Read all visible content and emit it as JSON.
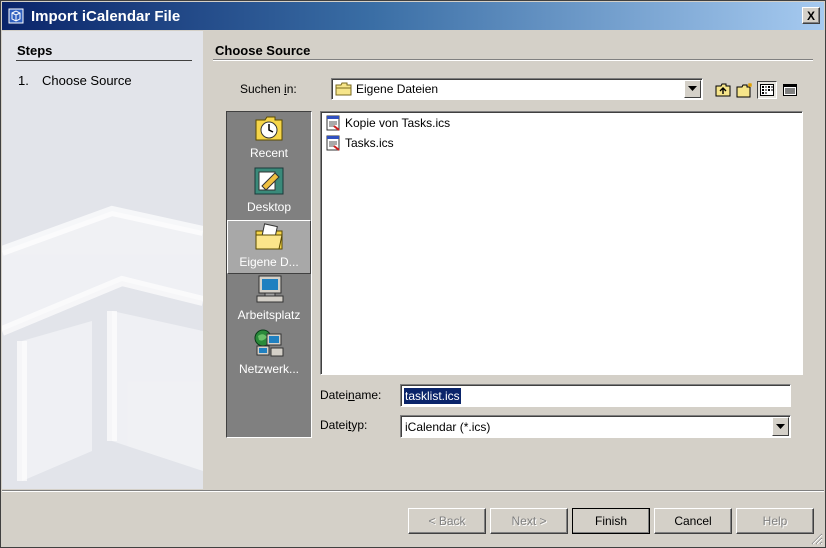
{
  "window": {
    "title": "Import iCalendar File",
    "close_label": "X"
  },
  "steps": {
    "title": "Steps",
    "items": [
      {
        "number": "1.",
        "label": "Choose Source"
      }
    ]
  },
  "main": {
    "title": "Choose Source"
  },
  "look_in": {
    "label_pre": "Suchen ",
    "label_mnemonic": "i",
    "label_post": "n:",
    "value": "Eigene Dateien"
  },
  "toolbar": {
    "icons": [
      "up-folder-icon",
      "new-folder-icon",
      "list-view-icon",
      "details-view-icon"
    ],
    "selected_view": "list"
  },
  "places": [
    {
      "label": "Recent",
      "icon": "recent-icon"
    },
    {
      "label": "Desktop",
      "icon": "desktop-icon"
    },
    {
      "label": "Eigene D...",
      "icon": "my-documents-icon",
      "selected": true
    },
    {
      "label": "Arbeitsplatz",
      "icon": "my-computer-icon"
    },
    {
      "label": "Netzwerk...",
      "icon": "network-icon"
    }
  ],
  "files": [
    {
      "name": "Kopie von Tasks.ics",
      "icon": "ics-file-icon"
    },
    {
      "name": "Tasks.ics",
      "icon": "ics-file-icon"
    }
  ],
  "filename": {
    "label_pre": "Datei",
    "label_mnemonic": "n",
    "label_post": "ame:",
    "value": "tasklist.ics"
  },
  "filetype": {
    "label_pre": "Datei",
    "label_mnemonic": "t",
    "label_post": "yp:",
    "value": "iCalendar (*.ics)"
  },
  "buttons": {
    "back": {
      "mnemonic": "B",
      "label": "< Back"
    },
    "next": {
      "label": "Next >"
    },
    "finish": {
      "mnemonic": "F",
      "label": "Finish"
    },
    "cancel": {
      "label": "Cancel"
    },
    "help": {
      "label": "Help"
    }
  },
  "colors": {
    "titlebar_start": "#0a246a",
    "titlebar_end": "#a6caf0",
    "face": "#d4d0c8",
    "selection": "#0a246a"
  }
}
